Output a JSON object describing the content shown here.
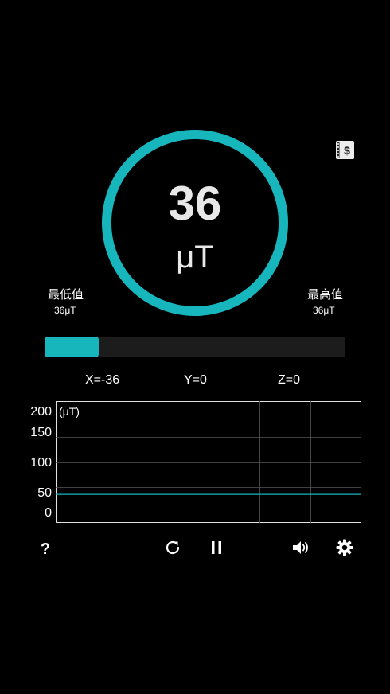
{
  "gauge": {
    "value": "36",
    "unit": "μT",
    "ring_color": "#17b6bd"
  },
  "min": {
    "label": "最低值",
    "value": "36μT"
  },
  "max": {
    "label": "最高值",
    "value": "36μT"
  },
  "progress": {
    "fraction": 0.18,
    "color": "#17b6bd"
  },
  "axes": {
    "x": "X=-36",
    "y": "Y=0",
    "z": "Z=0"
  },
  "chart_data": {
    "type": "line",
    "ylabel": "(μT)",
    "yticks": [
      "200",
      "150",
      "100",
      "50",
      "0"
    ],
    "ylim": [
      0,
      200
    ],
    "grid": true,
    "series": [
      {
        "values": [
          36,
          36,
          36,
          36,
          36,
          36,
          36
        ],
        "color": "#17b6bd"
      }
    ]
  },
  "toolbar": {
    "help": "?",
    "icons": [
      "refresh-icon",
      "pause-icon",
      "volume-icon",
      "gear-icon"
    ]
  },
  "ad_icon": "coupon-dollar-icon"
}
